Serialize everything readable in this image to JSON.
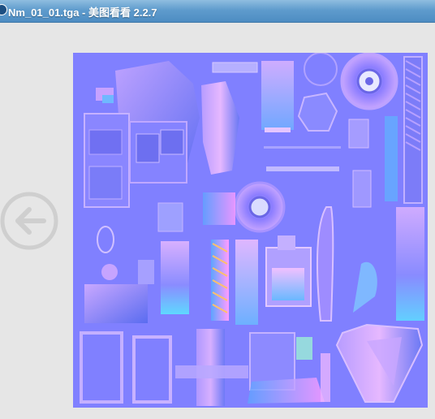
{
  "window": {
    "title": "Nm_01_01.tga - 美图看看 2.2.7"
  },
  "viewer": {
    "image_name": "Nm_01_01.tga",
    "image_kind": "normal map texture atlas",
    "background_color": "#e6e6e6",
    "normal_base_color": "#8080ff"
  },
  "icons": {
    "app": "app-logo-icon",
    "previous": "arrow-left-icon"
  }
}
